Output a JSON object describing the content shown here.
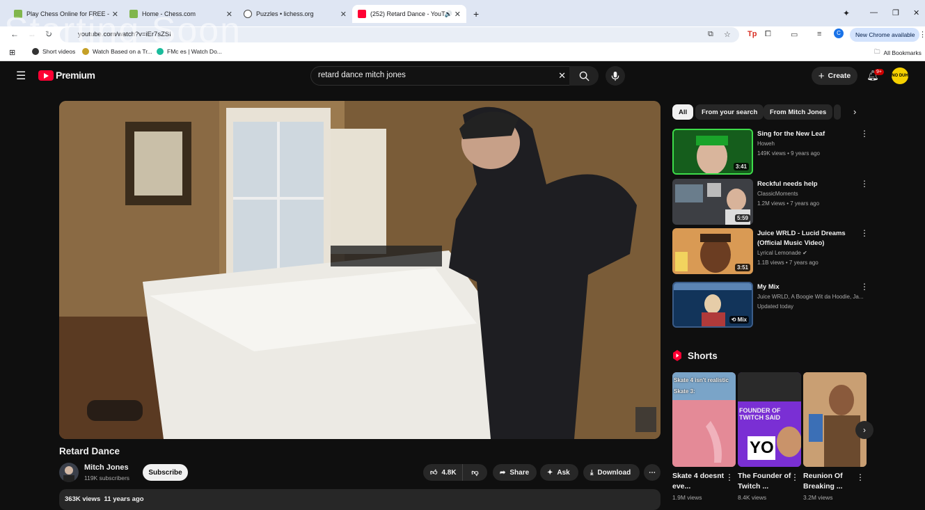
{
  "browser": {
    "tabs": [
      {
        "title": "Play Chess Online for FREE - 2",
        "favicon_color": "#81b64c"
      },
      {
        "title": "Home - Chess.com",
        "favicon_color": "#81b64c"
      },
      {
        "title": "Puzzles • lichess.org",
        "favicon_color": "#444444"
      },
      {
        "title": "(252) Retard Dance - YouTu",
        "favicon_color": "#ff0033"
      }
    ],
    "new_tab_symbol": "+",
    "url": "youtube.com/watch?v=iEr7sZSI",
    "new_chrome_label": "New Chrome available",
    "profile_initial": "C",
    "bookmarks": [
      {
        "label": "Short videos"
      },
      {
        "label": "Watch Based on a Tr..."
      },
      {
        "label": "FMc  es | Watch Do..."
      }
    ],
    "all_bookmarks": "All Bookmarks",
    "overlay_text": "Starting Soon"
  },
  "youtube": {
    "logo_text": "Premium",
    "search_value": "retard dance mitch jones",
    "create_label": "Create",
    "notifications_badge": "9+",
    "avatar_text": "NO DUH",
    "video": {
      "title": "Retard Dance",
      "channel": "Mitch Jones",
      "subscribers": "119K subscribers",
      "subscribe_label": "Subscribe",
      "likes": "4.8K",
      "share_label": "Share",
      "ask_label": "Ask",
      "download_label": "Download",
      "views_date": "363K views  11 years ago"
    },
    "chips": [
      "All",
      "From your search",
      "From Mitch Jones"
    ],
    "recommendations": [
      {
        "title": "Sing for the New Leaf",
        "channel": "Howeh",
        "meta": "149K views • 9 years ago",
        "duration": "3:41"
      },
      {
        "title": "Reckful needs help",
        "channel": "ClassicMoments",
        "meta": "1.2M views • 7 years ago",
        "duration": "5:59"
      },
      {
        "title": "Juice WRLD - Lucid Dreams (Official Music Video)",
        "channel": "Lyrical Lemonade",
        "meta": "1.1B views • 7 years ago",
        "duration": "3:51"
      },
      {
        "title": "My Mix",
        "channel": "Juice WRLD, A Boogie Wit da Hoodie, Ja...",
        "meta": "Updated today",
        "duration": "Mix"
      }
    ],
    "shorts_heading": "Shorts",
    "shorts": [
      {
        "title": "Skate 4 doesnt eve...",
        "views": "1.9M views",
        "overlay": "Skate 4 isn't realistic",
        "overlay2": "Skate 3:"
      },
      {
        "title": "The Founder of Twitch ...",
        "views": "8.4K views",
        "overlay": "FOUNDER OF TWITCH SAID",
        "overlay2": "YO"
      },
      {
        "title": "Reunion Of Breaking ...",
        "views": "3.2M views",
        "overlay": "",
        "overlay2": ""
      }
    ]
  }
}
